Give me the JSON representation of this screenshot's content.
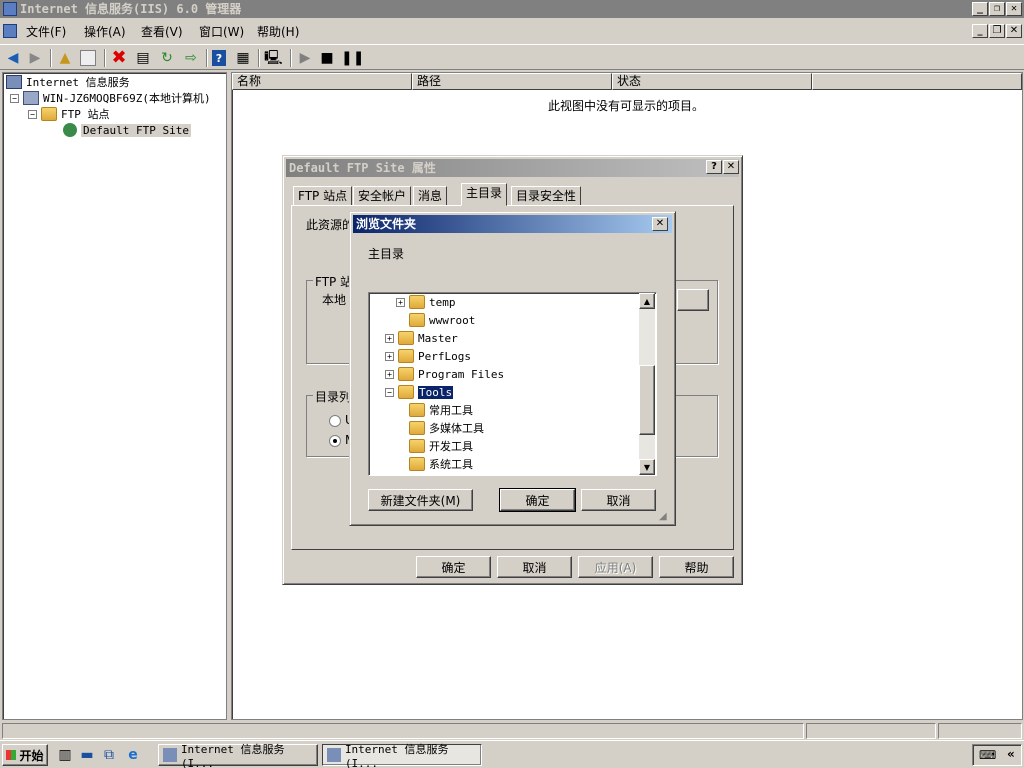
{
  "window": {
    "title": "Internet 信息服务(IIS) 6.0 管理器"
  },
  "menu": {
    "items": [
      "文件(F)",
      "操作(A)",
      "查看(V)",
      "窗口(W)",
      "帮助(H)"
    ]
  },
  "tree": {
    "root": "Internet 信息服务",
    "computer": "WIN-JZ6MOQBF69Z(本地计算机)",
    "ftp_sites": "FTP 站点",
    "default_site": "Default FTP Site"
  },
  "list": {
    "columns": [
      "名称",
      "路径",
      "状态"
    ],
    "empty_message": "此视图中没有可显示的项目。"
  },
  "props_dialog": {
    "title": "Default FTP Site 属性",
    "tabs": [
      "FTP 站点",
      "安全帐户",
      "消息",
      "主目录",
      "目录安全性"
    ],
    "content_source_label": "此资源的",
    "ftp_group_label": "FTP 站",
    "local_path_label": "本地",
    "dir_listing_label": "目录列",
    "radio_u": "U",
    "radio_m": "M",
    "buttons": {
      "ok": "确定",
      "cancel": "取消",
      "apply": "应用(A)",
      "help": "帮助"
    }
  },
  "browse_dialog": {
    "title": "浏览文件夹",
    "label": "主目录",
    "folders": [
      {
        "name": "temp",
        "expander": "+",
        "indent": 1
      },
      {
        "name": "wwwroot",
        "expander": "",
        "indent": 1
      },
      {
        "name": "Master",
        "expander": "+",
        "indent": 0
      },
      {
        "name": "PerfLogs",
        "expander": "+",
        "indent": 0
      },
      {
        "name": "Program Files",
        "expander": "+",
        "indent": 0
      },
      {
        "name": "Tools",
        "expander": "−",
        "indent": 0,
        "selected": true
      },
      {
        "name": "常用工具",
        "expander": "",
        "indent": 1
      },
      {
        "name": "多媒体工具",
        "expander": "",
        "indent": 1
      },
      {
        "name": "开发工具",
        "expander": "",
        "indent": 1
      },
      {
        "name": "系统工具",
        "expander": "",
        "indent": 1
      }
    ],
    "buttons": {
      "new_folder": "新建文件夹(M)",
      "ok": "确定",
      "cancel": "取消"
    }
  },
  "taskbar": {
    "start": "开始",
    "tasks": [
      "Internet 信息服务(I...",
      "Internet 信息服务(I..."
    ]
  },
  "colors": {
    "active_title_start": "#0a246a",
    "active_title_end": "#a6caf0",
    "selection": "#0a246a"
  }
}
